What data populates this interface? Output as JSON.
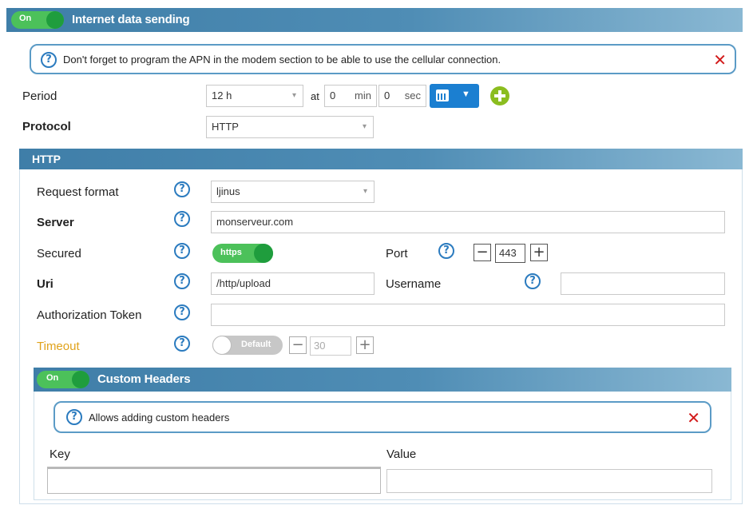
{
  "main_section": {
    "toggle_label": "On",
    "title": "Internet data sending"
  },
  "apn_notice": {
    "text": "Don't forget to program the APN in the modem section to be able to use the cellular connection."
  },
  "period": {
    "label": "Period",
    "value": "12 h",
    "at_label": "at",
    "minutes": "0",
    "min_label": "min",
    "seconds": "0",
    "sec_label": "sec"
  },
  "protocol": {
    "label": "Protocol",
    "value": "HTTP"
  },
  "http_section": {
    "title": "HTTP",
    "request_format": {
      "label": "Request format",
      "value": "ljinus"
    },
    "server": {
      "label": "Server",
      "value": "monserveur.com"
    },
    "secured": {
      "label": "Secured",
      "toggle_label": "https"
    },
    "port": {
      "label": "Port",
      "value": "443"
    },
    "uri": {
      "label": "Uri",
      "value": "/http/upload"
    },
    "username": {
      "label": "Username",
      "value": ""
    },
    "auth_token": {
      "label": "Authorization Token",
      "value": ""
    },
    "timeout": {
      "label": "Timeout",
      "toggle_label": "Default",
      "value": "30"
    }
  },
  "custom_headers": {
    "toggle_label": "On",
    "title": "Custom Headers",
    "notice": "Allows adding custom headers",
    "key_label": "Key",
    "value_label": "Value",
    "key_value": "",
    "value_value": ""
  },
  "colors": {
    "toggle_on": "#4cc15a",
    "toggle_knob": "#1f9d3d",
    "header_blue": "#4f8db5",
    "help_blue": "#2b7bbf",
    "close_red": "#d21a1a",
    "timeout_orange": "#e0a21a",
    "add_green": "#8bbd1f",
    "calendar_blue": "#1b7fd1"
  }
}
